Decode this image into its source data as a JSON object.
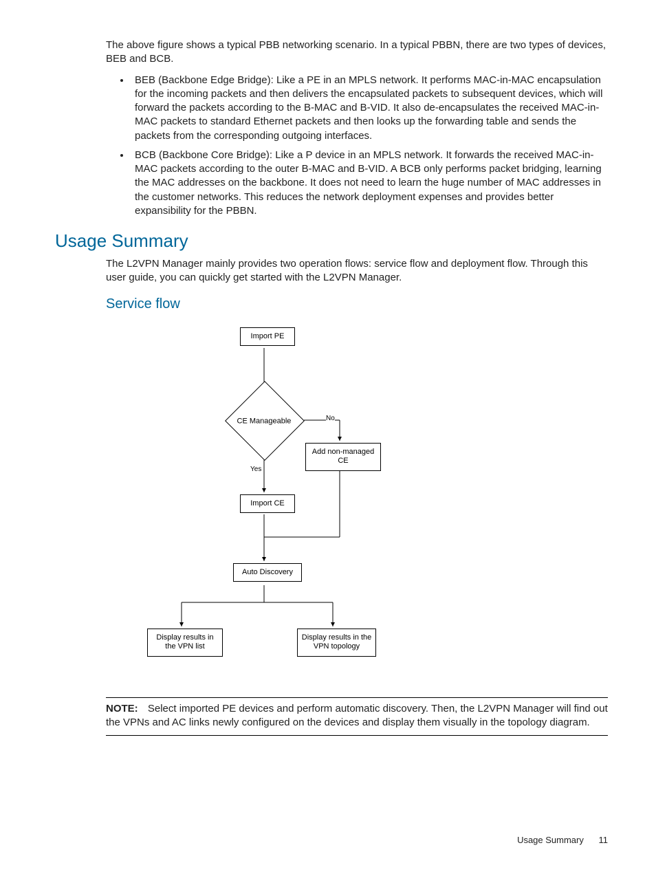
{
  "intro": "The above figure shows a typical PBB networking scenario. In a typical PBBN, there are two types of devices, BEB and BCB.",
  "bullets": [
    "BEB (Backbone Edge Bridge): Like a PE in an MPLS network. It performs MAC-in-MAC encapsulation for the incoming packets and then delivers the encapsulated packets to subsequent devices, which will forward the packets according to the B-MAC and B-VID. It also de-encapsulates the received MAC-in-MAC packets to standard Ethernet packets and then looks up the forwarding table and sends the packets from the corresponding outgoing interfaces.",
    "BCB (Backbone Core Bridge): Like a P device in an MPLS network. It forwards the received MAC-in-MAC packets according to the outer B-MAC and B-VID. A BCB only performs packet bridging, learning the MAC addresses on the backbone. It does not need to learn the huge number of MAC addresses in the customer networks. This reduces the network deployment expenses and provides better expansibility for the PBBN."
  ],
  "h1": "Usage Summary",
  "body": "The L2VPN Manager mainly provides two operation flows: service flow and deployment flow. Through this user guide, you can quickly get started with the L2VPN Manager.",
  "h2": "Service flow",
  "flow": {
    "import_pe": "Import PE",
    "decision": "CE Manageable",
    "no": "No",
    "yes": "Yes",
    "add_non": "Add non-managed CE",
    "import_ce": "Import CE",
    "auto": "Auto Discovery",
    "left": "Display results in the VPN list",
    "right": "Display results in the VPN topology"
  },
  "note_label": "NOTE:",
  "note_text": "Select imported PE devices and perform automatic discovery. Then, the L2VPN Manager will find out the VPNs and AC links newly configured on the devices and display them visually in the topology diagram.",
  "footer_title": "Usage Summary",
  "page_no": "11"
}
